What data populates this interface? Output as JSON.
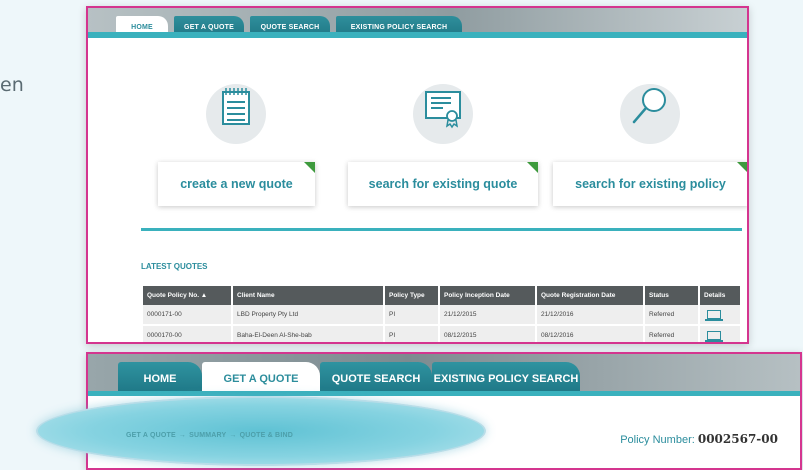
{
  "side_text": "en",
  "top_panel": {
    "tabs": [
      {
        "label": "HOME",
        "active": true
      },
      {
        "label": "GET A QUOTE",
        "active": false
      },
      {
        "label": "QUOTE SEARCH",
        "active": false
      },
      {
        "label": "EXISTING POLICY SEARCH",
        "active": false
      }
    ],
    "features": [
      {
        "label": "create a new quote",
        "icon": "notepad-icon"
      },
      {
        "label": "search for existing quote",
        "icon": "certificate-icon"
      },
      {
        "label": "search for existing policy",
        "icon": "magnifier-icon"
      }
    ],
    "section_title": "LATEST QUOTES",
    "table": {
      "columns": [
        "Quote Policy No. ▲",
        "Client Name",
        "Policy Type",
        "Policy Inception Date",
        "Quote Registration Date",
        "Status",
        "Details"
      ],
      "rows": [
        [
          "0000171-00",
          "LBD Property Pty Ltd",
          "PI",
          "21/12/2015",
          "21/12/2016",
          "Referred"
        ],
        [
          "0000170-00",
          "Baha-El-Deen Al-She-bab",
          "PI",
          "08/12/2015",
          "08/12/2016",
          "Referred"
        ]
      ]
    }
  },
  "bottom_panel": {
    "tabs": [
      {
        "label": "HOME",
        "active": false
      },
      {
        "label": "GET A QUOTE",
        "active": true
      },
      {
        "label": "QUOTE SEARCH",
        "active": false
      },
      {
        "label": "EXISTING POLICY SEARCH",
        "active": false
      }
    ],
    "breadcrumb": {
      "steps": [
        "GET A QUOTE",
        "SUMMARY",
        "QUOTE & BIND"
      ],
      "separator": "→"
    },
    "policy_number_label": "Policy Number:",
    "policy_number_value": "0002567-00"
  },
  "colors": {
    "accent_teal": "#3ab1bd",
    "text_teal": "#2b8d9d",
    "highlight_magenta": "#d4358f",
    "corner_green": "#3e9a3d"
  }
}
